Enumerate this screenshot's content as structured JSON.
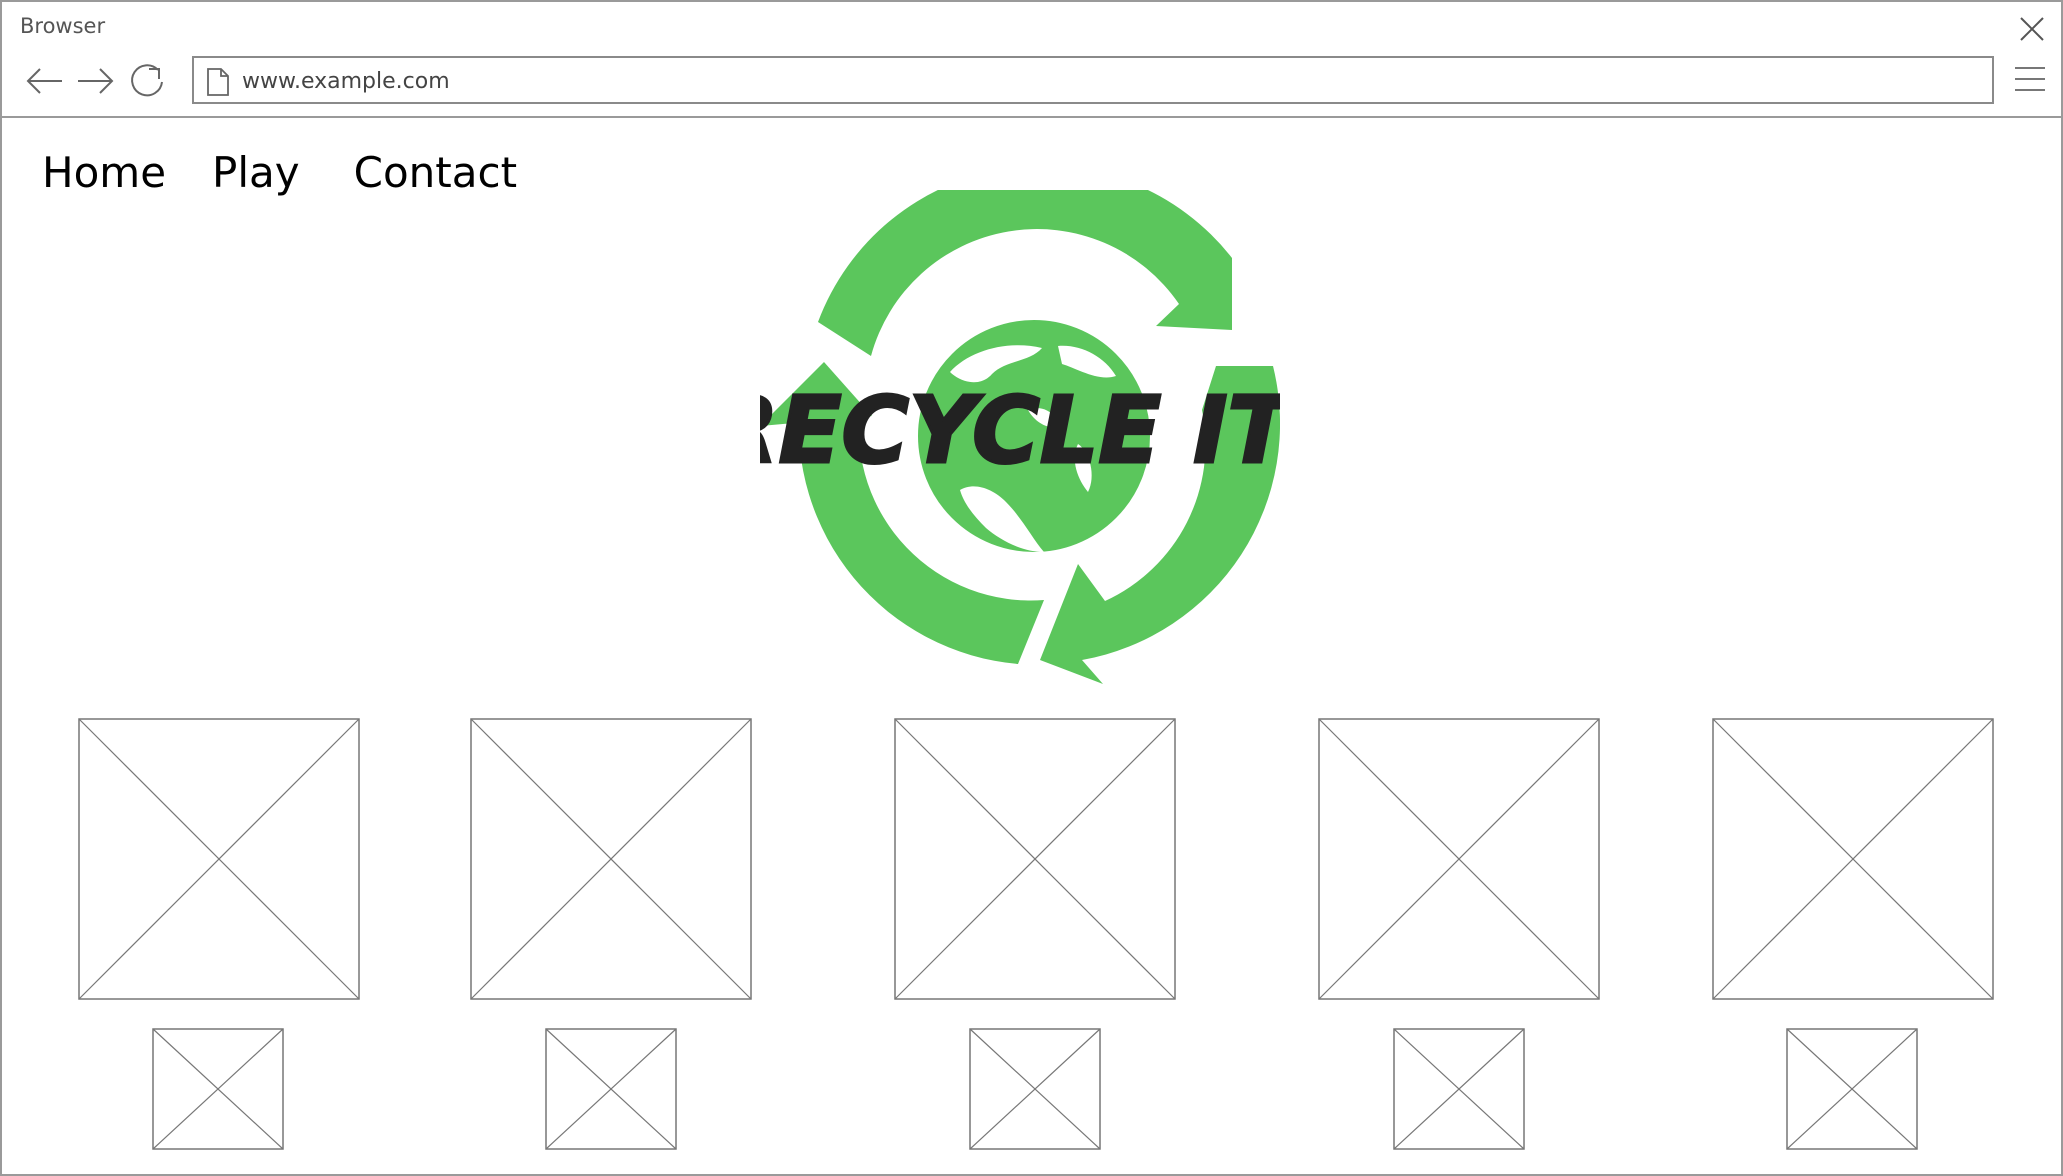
{
  "window": {
    "title": "Browser"
  },
  "toolbar": {
    "url": "www.example.com",
    "icons": {
      "back": "arrow-left-icon",
      "forward": "arrow-right-icon",
      "reload": "reload-icon",
      "page": "page-icon",
      "menu": "hamburger-menu-icon",
      "close": "close-icon"
    }
  },
  "nav": {
    "items": [
      {
        "label": "Home"
      },
      {
        "label": "Play"
      },
      {
        "label": "Contact"
      }
    ]
  },
  "logo": {
    "text": "RECYCLE IT!",
    "arrow_color": "#5bc65c",
    "text_color": "#222222"
  },
  "gallery": {
    "large_count": 5,
    "small_count": 5
  }
}
